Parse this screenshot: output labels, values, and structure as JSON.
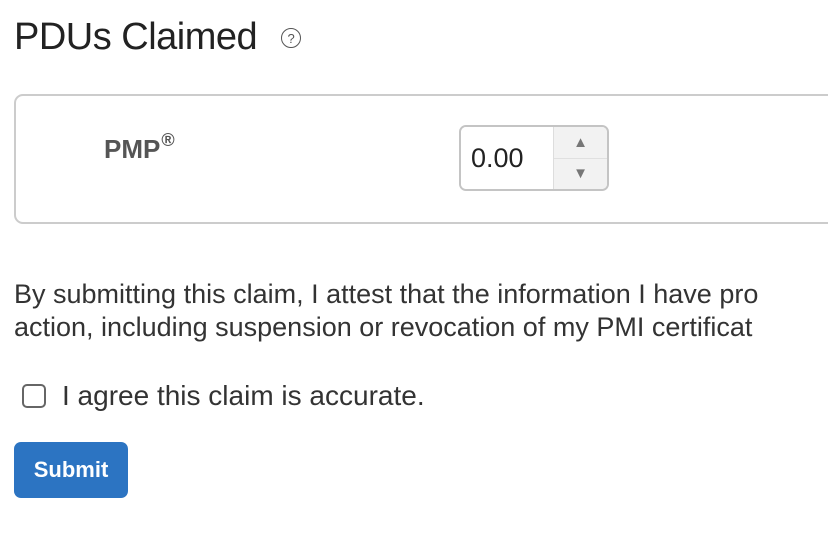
{
  "header": {
    "title": "PDUs Claimed",
    "help_icon": "question-circle-icon",
    "help_glyph": "?"
  },
  "pdu_box": {
    "certification": "PMP",
    "registered_mark": "®",
    "value": "0.00",
    "up_glyph": "▲",
    "down_glyph": "▼"
  },
  "attestation": {
    "line1": "By submitting this claim, I attest that the information I have pro",
    "line2": "action, including suspension or revocation of my PMI certificat"
  },
  "agreement": {
    "checked": false,
    "label": "I agree this claim is accurate."
  },
  "actions": {
    "submit_label": "Submit",
    "submit_color": "#2c74c2"
  }
}
